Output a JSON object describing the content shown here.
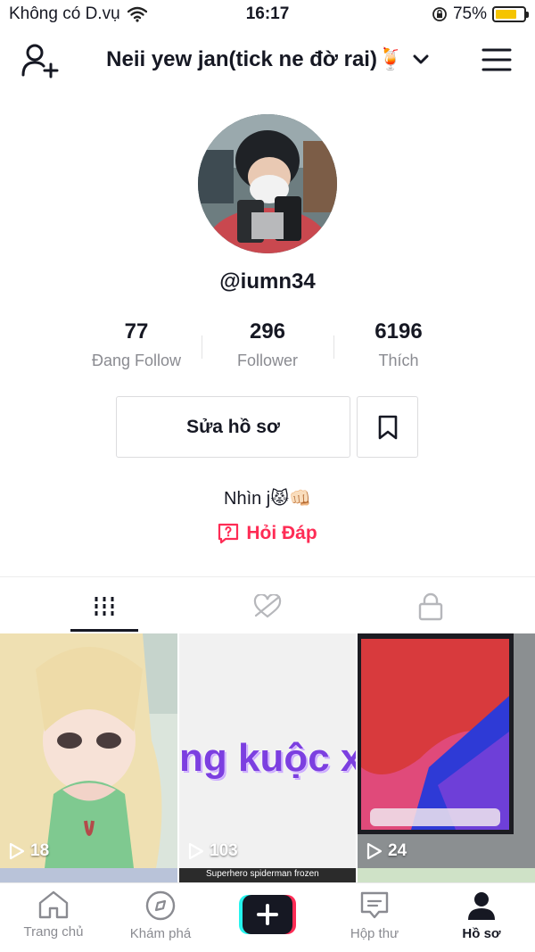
{
  "status_bar": {
    "carrier": "Không có D.vụ",
    "time": "16:17",
    "battery": "75%",
    "battery_level": 0.75
  },
  "header": {
    "title": "Neii yew jan(tick ne đờ rai)🍹",
    "add_user_icon": "add-user-icon",
    "menu_icon": "hamburger-menu-icon"
  },
  "profile": {
    "username": "@iumn34",
    "stats": [
      {
        "value": "77",
        "label": "Đang Follow"
      },
      {
        "value": "296",
        "label": "Follower"
      },
      {
        "value": "6196",
        "label": "Thích"
      }
    ],
    "edit_label": "Sửa hồ sơ",
    "bio": "Nhìn j😾👊🏻",
    "qa_label": "Hỏi Đáp"
  },
  "tabs": [
    {
      "icon": "grid-icon",
      "active": true
    },
    {
      "icon": "liked-hidden-icon",
      "active": false
    },
    {
      "icon": "lock-icon",
      "active": false
    }
  ],
  "videos": [
    {
      "views": "18",
      "caption": ""
    },
    {
      "views": "103",
      "caption": "ng kuộc x"
    },
    {
      "views": "24",
      "caption": ""
    }
  ],
  "second_row": {
    "caption": "Superhero spiderman frozen"
  },
  "bottom_nav": [
    {
      "label": "Trang chủ",
      "icon": "home-icon",
      "active": false
    },
    {
      "label": "Khám phá",
      "icon": "compass-icon",
      "active": false
    },
    {
      "label": "",
      "icon": "plus-icon",
      "active": false
    },
    {
      "label": "Hộp thư",
      "icon": "inbox-icon",
      "active": false
    },
    {
      "label": "Hồ sơ",
      "icon": "profile-icon",
      "active": true
    }
  ],
  "colors": {
    "accent": "#fe2c55",
    "create_cyan": "#25f4ee",
    "battery": "#f5c400"
  }
}
